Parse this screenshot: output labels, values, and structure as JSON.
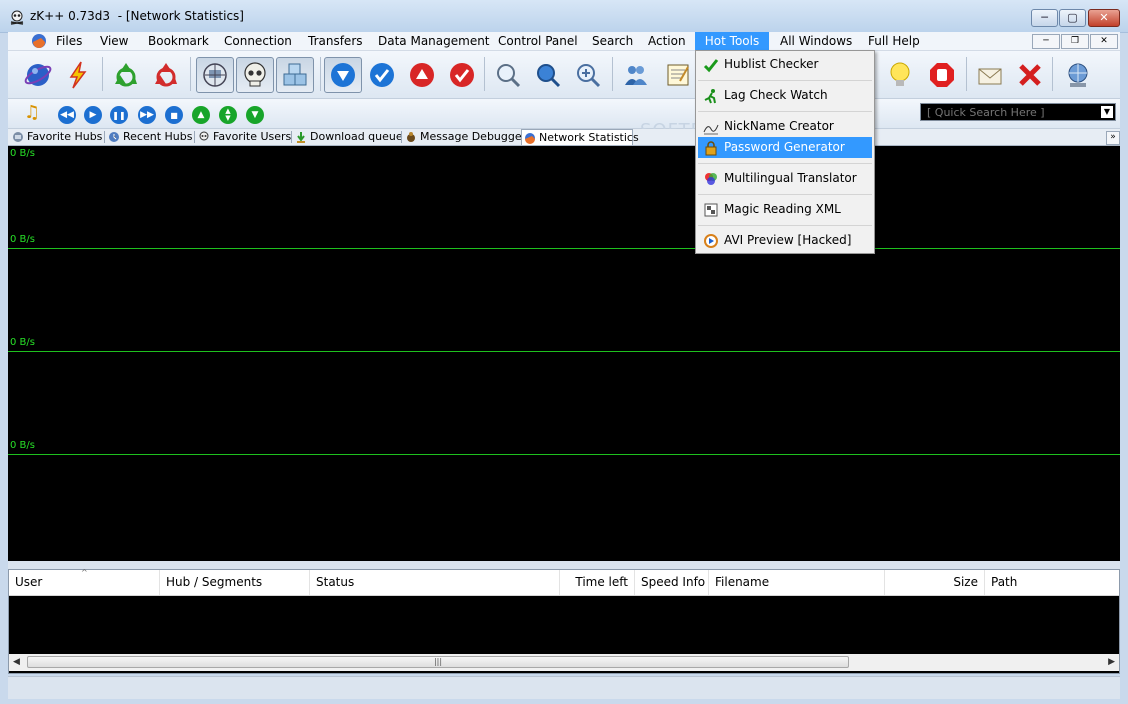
{
  "window": {
    "title": "zK++ 0.73d3  - [Network Statistics]",
    "controls": {
      "minimize": "─",
      "maximize": "▢",
      "close": "✕"
    }
  },
  "menu": {
    "items": [
      "Files",
      "View",
      "Bookmark",
      "Connection",
      "Transfers",
      "Data Management",
      "Control Panel",
      "Search",
      "Action",
      "Hot Tools",
      "All Windows",
      "Full Help"
    ],
    "active": "Hot Tools",
    "mdi_controls": {
      "minimize": "─",
      "restore": "❐",
      "close": "✕"
    }
  },
  "toolbar": {
    "icons": [
      "globe-icon",
      "lightning-icon",
      "recycle-green-icon",
      "recycle-red-icon",
      "network-icon",
      "skull-icon",
      "boxes-icon",
      "download-icon",
      "check-blue-icon",
      "upload-icon",
      "check-red-icon",
      "search-icon",
      "search-globe-icon",
      "zoom-icon",
      "users-icon",
      "notepad-icon",
      "lightbulb-icon",
      "stop-icon",
      "mail-icon",
      "close-red-icon",
      "network-globe-icon"
    ]
  },
  "media_bar": {
    "controls": [
      "music-note-icon",
      "previous-icon",
      "play-icon",
      "pause-icon",
      "next-icon",
      "stop-icon",
      "up-icon",
      "up-down-icon",
      "down-icon"
    ],
    "quick_search": {
      "placeholder": "[ Quick Search Here ]",
      "value": ""
    }
  },
  "tabs": [
    {
      "label": "Favorite Hubs",
      "icon": "favorite-hubs-icon"
    },
    {
      "label": "Recent Hubs",
      "icon": "recent-hubs-icon"
    },
    {
      "label": "Favorite Users",
      "icon": "favorite-users-icon"
    },
    {
      "label": "Download queue",
      "icon": "download-queue-icon"
    },
    {
      "label": "Message Debugger",
      "icon": "debugger-icon"
    },
    {
      "label": "Network Statistics",
      "icon": "network-stats-icon",
      "selected": true
    }
  ],
  "tabs_overflow": "»",
  "chart": {
    "labels": [
      "0 B/s",
      "0 B/s",
      "0 B/s",
      "0 B/s"
    ],
    "line_color": "#1ec01e",
    "background": "#000000"
  },
  "transfers_table": {
    "columns": [
      "User",
      "Hub / Segments",
      "Status",
      "Time left",
      "Speed Info",
      "Filename",
      "Size",
      "Path"
    ],
    "rows": [],
    "scroll_left": "◀",
    "scroll_right": "▶",
    "scroll_grip": "|||"
  },
  "hot_tools_menu": {
    "items": [
      {
        "label": "Hublist Checker",
        "icon": "check-green-icon"
      },
      {
        "label": "Lag Check Watch",
        "icon": "runner-icon"
      },
      {
        "label": "NickName Creator",
        "icon": "signature-icon"
      },
      {
        "label": "Password Generator",
        "icon": "lock-icon",
        "highlighted": true
      },
      {
        "label": "Multilingual Translator",
        "icon": "translator-icon"
      },
      {
        "label": "Magic Reading XML",
        "icon": "xml-icon"
      },
      {
        "label": "AVI Preview [Hacked]",
        "icon": "avi-preview-icon"
      }
    ]
  },
  "colors": {
    "menu_highlight": "#3399ff",
    "chart_text": "#27e027",
    "quick_search_text": "#1bd81b"
  }
}
